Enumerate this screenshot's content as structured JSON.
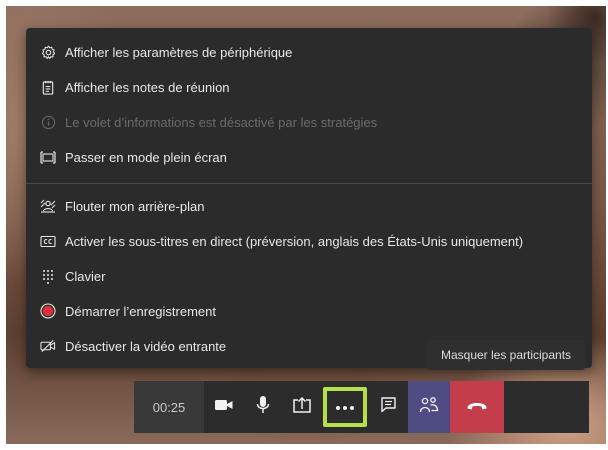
{
  "menu": {
    "items": [
      {
        "icon": "gear-icon",
        "label": "Afficher les paramètres de périphérique",
        "disabled": false
      },
      {
        "icon": "notes-icon",
        "label": "Afficher les notes de réunion",
        "disabled": false
      },
      {
        "icon": "info-icon",
        "label": "Le volet d’informations est désactivé par les stratégies",
        "disabled": true
      },
      {
        "icon": "fullscreen-icon",
        "label": "Passer en mode plein écran",
        "disabled": false
      },
      {
        "icon": "blur-background-icon",
        "label": "Flouter mon arrière-plan",
        "disabled": false
      },
      {
        "icon": "closed-captions-icon",
        "label": "Activer les sous-titres en direct (préversion, anglais des États-Unis uniquement)",
        "disabled": false
      },
      {
        "icon": "keypad-icon",
        "label": "Clavier",
        "disabled": false
      },
      {
        "icon": "record-icon",
        "label": "Démarrer l’enregistrement",
        "disabled": false
      },
      {
        "icon": "video-off-icon",
        "label": "Désactiver la vidéo entrante",
        "disabled": false
      }
    ]
  },
  "tooltip": {
    "label": "Masquer les participants"
  },
  "controls": {
    "timer": "00:25",
    "buttons": [
      "camera-icon",
      "microphone-icon",
      "share-screen-icon",
      "more-options-icon",
      "chat-icon",
      "participants-icon",
      "hang-up-icon"
    ]
  },
  "colors": {
    "menu_bg": "#2b2b2b",
    "highlight": "#b5e04a",
    "participants_active": "#4f4c83",
    "hang_up": "#c43d4b",
    "record": "#e0303a"
  }
}
